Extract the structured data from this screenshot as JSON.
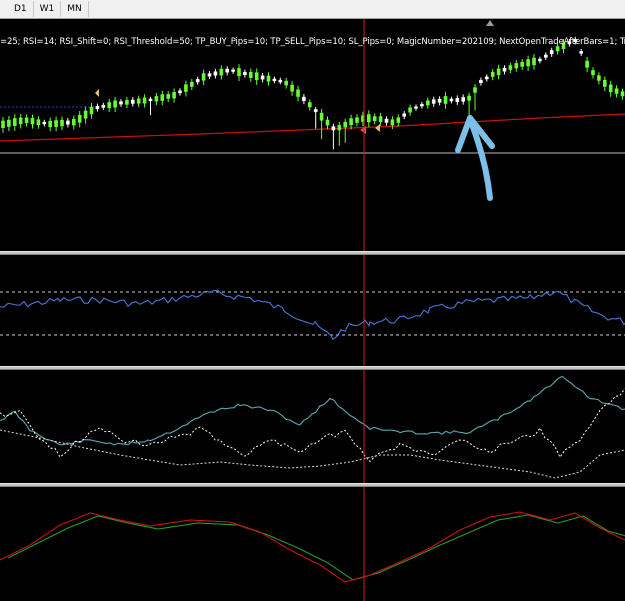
{
  "toolbar": {
    "timeframes": [
      {
        "label": "D1"
      },
      {
        "label": "W1"
      },
      {
        "label": "MN"
      }
    ]
  },
  "chart": {
    "params_text": "=25; RSI=14; RSI_Shift=0; RSI_Threshold=50; TP_BUY_Pips=10; TP_SELL_Pips=10; SL_Pips=0; MagicNumber=202109; NextOpenTradeAfterBars=1; Trad",
    "colors": {
      "background": "#000000",
      "bull": "#66ff33",
      "bear": "#ffffff",
      "ma": "#cc1111",
      "rsi": "#4a78d8",
      "cursor": "#e01818",
      "stoch_main": "#5aaab0",
      "macd_a": "#cc1111",
      "macd_b": "#2a9a2a",
      "annotation": "#7cc0ea"
    },
    "icons": {
      "arrow": "arrow-up-annotation-icon",
      "trade": "trade-arrow-icon"
    }
  }
}
